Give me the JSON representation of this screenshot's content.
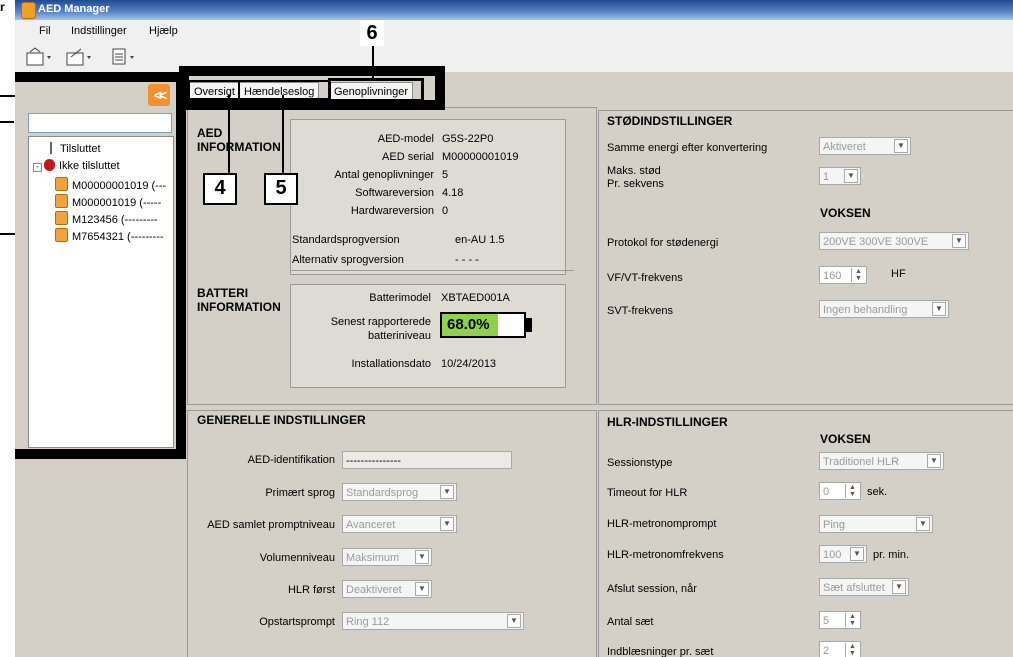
{
  "window": {
    "title": "AED Manager"
  },
  "menu": [
    "Fil",
    "Indstillinger",
    "Hjælp"
  ],
  "icons": {
    "toolbar": [
      "import-icon",
      "export-icon",
      "report-icon"
    ],
    "collapse": "double-chevron-left-icon"
  },
  "search": {
    "value": ""
  },
  "tree": {
    "connected": "Tilsluttet",
    "not_connected": "Ikke tilsluttet",
    "devices": [
      "M00000001019 (---",
      "M000001019 (-----",
      "M123456 (---------",
      "M7654321 (---------"
    ]
  },
  "tabs": [
    "Oversigt",
    "Hændelseslog",
    "Genoplivninger"
  ],
  "callouts": {
    "tab_restore": "6",
    "tab_overview": "4",
    "tab_eventlog": "5"
  },
  "aed_info": {
    "title_line1": "AED",
    "title_line2": "INFORMATION",
    "rows": [
      {
        "label": "AED-model",
        "value": "G5S-22P0"
      },
      {
        "label": "AED serial",
        "value": "M00000001019"
      },
      {
        "label": "Antal genoplivninger",
        "value": "5"
      },
      {
        "label": "Softwareversion",
        "value": "4.18"
      },
      {
        "label": "Hardwareversion",
        "value": "0"
      }
    ],
    "lang_rows": [
      {
        "label": "Standardsprogversion",
        "value": "en-AU  1.5"
      },
      {
        "label": "Alternativ sprogversion",
        "value": "- - - -"
      }
    ]
  },
  "battery": {
    "title_line1": "BATTERI",
    "title_line2": "INFORMATION",
    "model_label": "Batterimodel",
    "model_value": "XBTAED001A",
    "level_label_1": "Senest rapporterede",
    "level_label_2": "batteriniveau",
    "level_text": "68.0%",
    "level_fraction": 0.68,
    "install_label": "Installationsdato",
    "install_value": "10/24/2013"
  },
  "general": {
    "title": "GENERELLE INDSTILLINGER",
    "rows": [
      {
        "label": "AED-identifikation",
        "value": "---------------"
      },
      {
        "label": "Primært sprog",
        "value": "Standardsprog"
      },
      {
        "label": "AED samlet promptniveau",
        "value": "Avanceret"
      },
      {
        "label": "Volumenniveau",
        "value": "Maksimum"
      },
      {
        "label": "HLR først",
        "value": "Deaktiveret"
      },
      {
        "label": "Opstartsprompt",
        "value": "Ring 112"
      }
    ]
  },
  "shock": {
    "title": "STØDINDSTILLINGER",
    "same_energy_label": "Samme energi efter konvertering",
    "same_energy_value": "Aktiveret",
    "max_shock_label_1": "Maks. stød",
    "max_shock_label_2": "Pr. sekvens",
    "max_shock_value": "1",
    "adult_header": "VOKSEN",
    "protocol_label": "Protokol for stødenergi",
    "protocol_value": "200VE 300VE 300VE",
    "vf_label": "VF/VT-frekvens",
    "vf_value": "160",
    "vf_unit": "HF",
    "svt_label": "SVT-frekvens",
    "svt_value": "Ingen behandling"
  },
  "cpr": {
    "title": "HLR-INDSTILLINGER",
    "adult_header": "VOKSEN",
    "session_label": "Sessionstype",
    "session_value": "Traditionel HLR",
    "timeout_label": "Timeout for HLR",
    "timeout_value": "0",
    "timeout_unit": "sek.",
    "metronome_label": "HLR-metronomprompt",
    "metronome_value": "Ping",
    "metronome_freq_label": "HLR-metronomfrekvens",
    "metronome_freq_value": "100",
    "metronome_freq_unit": "pr. min.",
    "end_label": "Afslut session, når",
    "end_value": "Sæt afsluttet",
    "sets_label": "Antal sæt",
    "sets_value": "5",
    "breaths_label": "Indblæsninger pr. sæt",
    "breaths_value": "2"
  }
}
